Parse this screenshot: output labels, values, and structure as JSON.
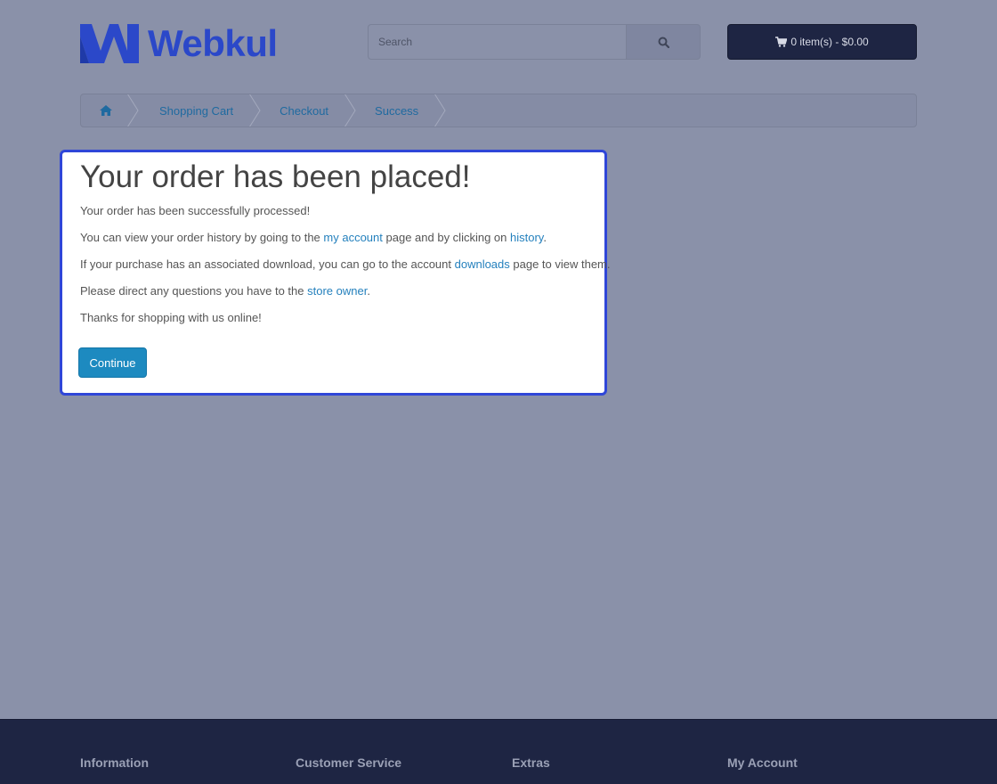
{
  "header": {
    "logo_text": "Webkul",
    "search": {
      "placeholder": "Search",
      "value": ""
    },
    "cart_label": "0 item(s) - $0.00"
  },
  "breadcrumb": {
    "items": [
      {
        "label": "Shopping Cart"
      },
      {
        "label": "Checkout"
      },
      {
        "label": "Success"
      }
    ]
  },
  "success": {
    "title": "Your order has been placed!",
    "line1": "Your order has been successfully processed!",
    "line2": {
      "pre": "You can view your order history by going to the ",
      "link1": "my account",
      "mid": " page and by clicking on ",
      "link2": "history",
      "post": "."
    },
    "line3": {
      "pre": "If your purchase has an associated download, you can go to the account ",
      "link": "downloads",
      "post": " page to view them."
    },
    "line4": {
      "pre": "Please direct any questions you have to the ",
      "link": "store owner",
      "post": "."
    },
    "line5": "Thanks for shopping with us online!",
    "continue_label": "Continue"
  },
  "footer": {
    "columns": [
      {
        "title": "Information"
      },
      {
        "title": "Customer Service"
      },
      {
        "title": "Extras"
      },
      {
        "title": "My Account"
      }
    ]
  },
  "colors": {
    "page_bg": "#8a91a9",
    "brand_blue": "#2b48c9",
    "link": "#2480bd",
    "primary_button": "#1d8ac0",
    "cart_button": "#1e2543",
    "footer_bg": "#1e2543",
    "highlight_border": "#2f46d8"
  },
  "icons": {
    "search": "search-icon",
    "cart": "shopping-cart-icon",
    "home": "home-icon"
  }
}
